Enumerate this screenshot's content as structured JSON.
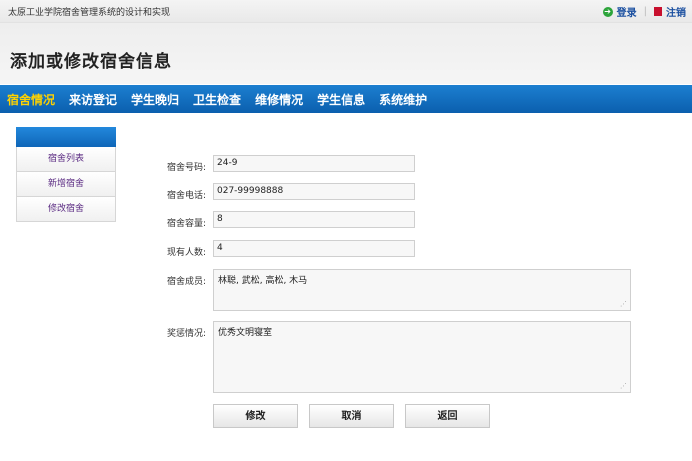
{
  "app": {
    "site_name": "太原工业学院宿舍管理系统的设计和实现"
  },
  "topbar": {
    "login_label": "登录",
    "logout_label": "注销"
  },
  "page": {
    "title": "添加或修改宿舍信息"
  },
  "nav": {
    "items": [
      {
        "label": "宿舍情况",
        "active": true
      },
      {
        "label": "来访登记",
        "active": false
      },
      {
        "label": "学生晚归",
        "active": false
      },
      {
        "label": "卫生检查",
        "active": false
      },
      {
        "label": "维修情况",
        "active": false
      },
      {
        "label": "学生信息",
        "active": false
      },
      {
        "label": "系统维护",
        "active": false
      }
    ]
  },
  "sidebar": {
    "items": [
      {
        "label": "宿舍列表"
      },
      {
        "label": "新增宿舍"
      },
      {
        "label": "修改宿舍"
      }
    ]
  },
  "form": {
    "dorm_number": {
      "label": "宿舍号码:",
      "value": "24-9"
    },
    "dorm_phone": {
      "label": "宿舍电话:",
      "value": "027-99998888"
    },
    "capacity": {
      "label": "宿舍容量:",
      "value": "8"
    },
    "current_count": {
      "label": "现有人数:",
      "value": "4"
    },
    "members": {
      "label": "宿舍成员:",
      "value": "林聪, 武松, 高松, 木马"
    },
    "awards": {
      "label": "奖惩情况:",
      "value": "优秀文明寝室"
    }
  },
  "buttons": {
    "modify": "修改",
    "cancel": "取消",
    "back": "返回"
  },
  "colors": {
    "nav_blue": "#0b5fae",
    "nav_active": "#ffd200",
    "sidebar_text": "#5a2a82"
  }
}
